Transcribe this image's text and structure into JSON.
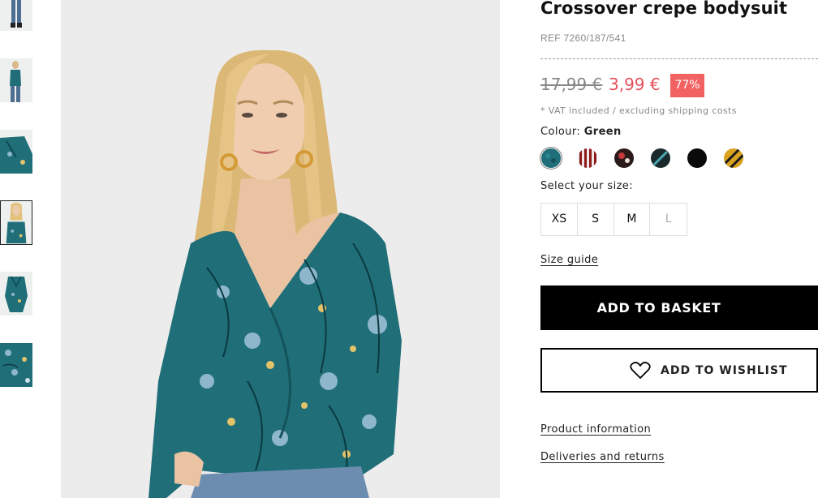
{
  "gallery": {
    "thumbnails": [
      {
        "name": "thumb-front-full"
      },
      {
        "name": "thumb-side"
      },
      {
        "name": "thumb-detail"
      },
      {
        "name": "thumb-front-closeup"
      },
      {
        "name": "thumb-flatlay"
      },
      {
        "name": "thumb-fabric"
      }
    ],
    "active_index": 3
  },
  "product": {
    "title": "Crossover crepe bodysuit",
    "ref": "REF 7260/187/541",
    "price_old": "17,99 €",
    "price_new": "3,99 €",
    "discount": "77%",
    "vat_note": "* VAT included / excluding shipping costs",
    "colour_label": "Colour:",
    "colour_value": "Green",
    "size_label": "Select your size:",
    "sizes": [
      {
        "label": "XS",
        "available": true
      },
      {
        "label": "S",
        "available": true
      },
      {
        "label": "M",
        "available": true
      },
      {
        "label": "L",
        "available": false
      }
    ],
    "size_guide": "Size guide",
    "add_to_basket": "ADD TO BASKET",
    "add_to_wishlist": "ADD TO WISHLIST",
    "product_information": "Product information",
    "deliveries_returns": "Deliveries and returns"
  },
  "colours": [
    {
      "name": "green-floral",
      "base": "#1f6e78",
      "selected": true
    },
    {
      "name": "red-stripe",
      "base": "#8b1a1a",
      "selected": false
    },
    {
      "name": "red-floral",
      "base": "#2a1a1a",
      "selected": false
    },
    {
      "name": "teal-black",
      "base": "#1a2a2c",
      "selected": false
    },
    {
      "name": "black",
      "base": "#0a0a0a",
      "selected": false
    },
    {
      "name": "mustard-stripe",
      "base": "#d9a21f",
      "selected": false
    }
  ],
  "icons": {
    "wishlist": "heart-icon"
  },
  "colors": {
    "discount_badge": "#f26262",
    "sale_price": "#e8505b",
    "basket_button": "#000000"
  }
}
